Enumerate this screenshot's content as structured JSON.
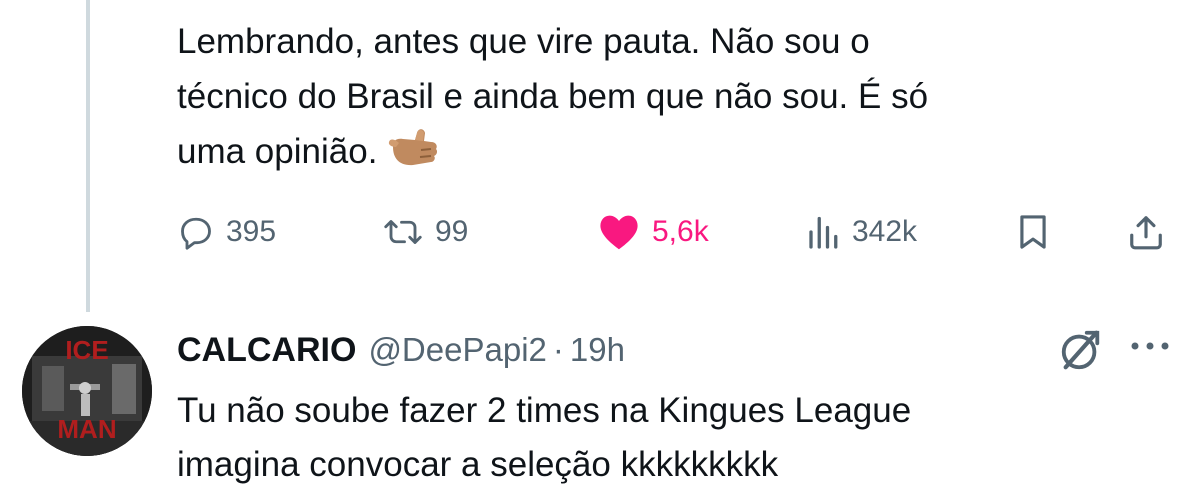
{
  "tweet": {
    "lines": [
      "Lembrando, antes que vire pauta. Não sou o",
      "técnico do Brasil e ainda bem que não sou. É só",
      "uma opinião."
    ],
    "emoji_icon": "call-me-hand-icon",
    "actions": {
      "replies": "395",
      "retweets": "99",
      "likes": "5,6k",
      "views": "342k"
    },
    "like_color": "#f91880"
  },
  "reply": {
    "avatar_text_top": "ICE",
    "avatar_text_bottom": "MAN",
    "name": "CALCARIO",
    "handle": "@DeePapi2",
    "separator": "·",
    "time": "19h",
    "lines": [
      "Tu não soube fazer 2 times na Kingues League",
      "imagina convocar a seleção kkkkkkkkk"
    ]
  },
  "colors": {
    "text": "#0f1419",
    "secondary": "#536471",
    "thread_line": "#cfd9de",
    "accent_like": "#f91880"
  }
}
